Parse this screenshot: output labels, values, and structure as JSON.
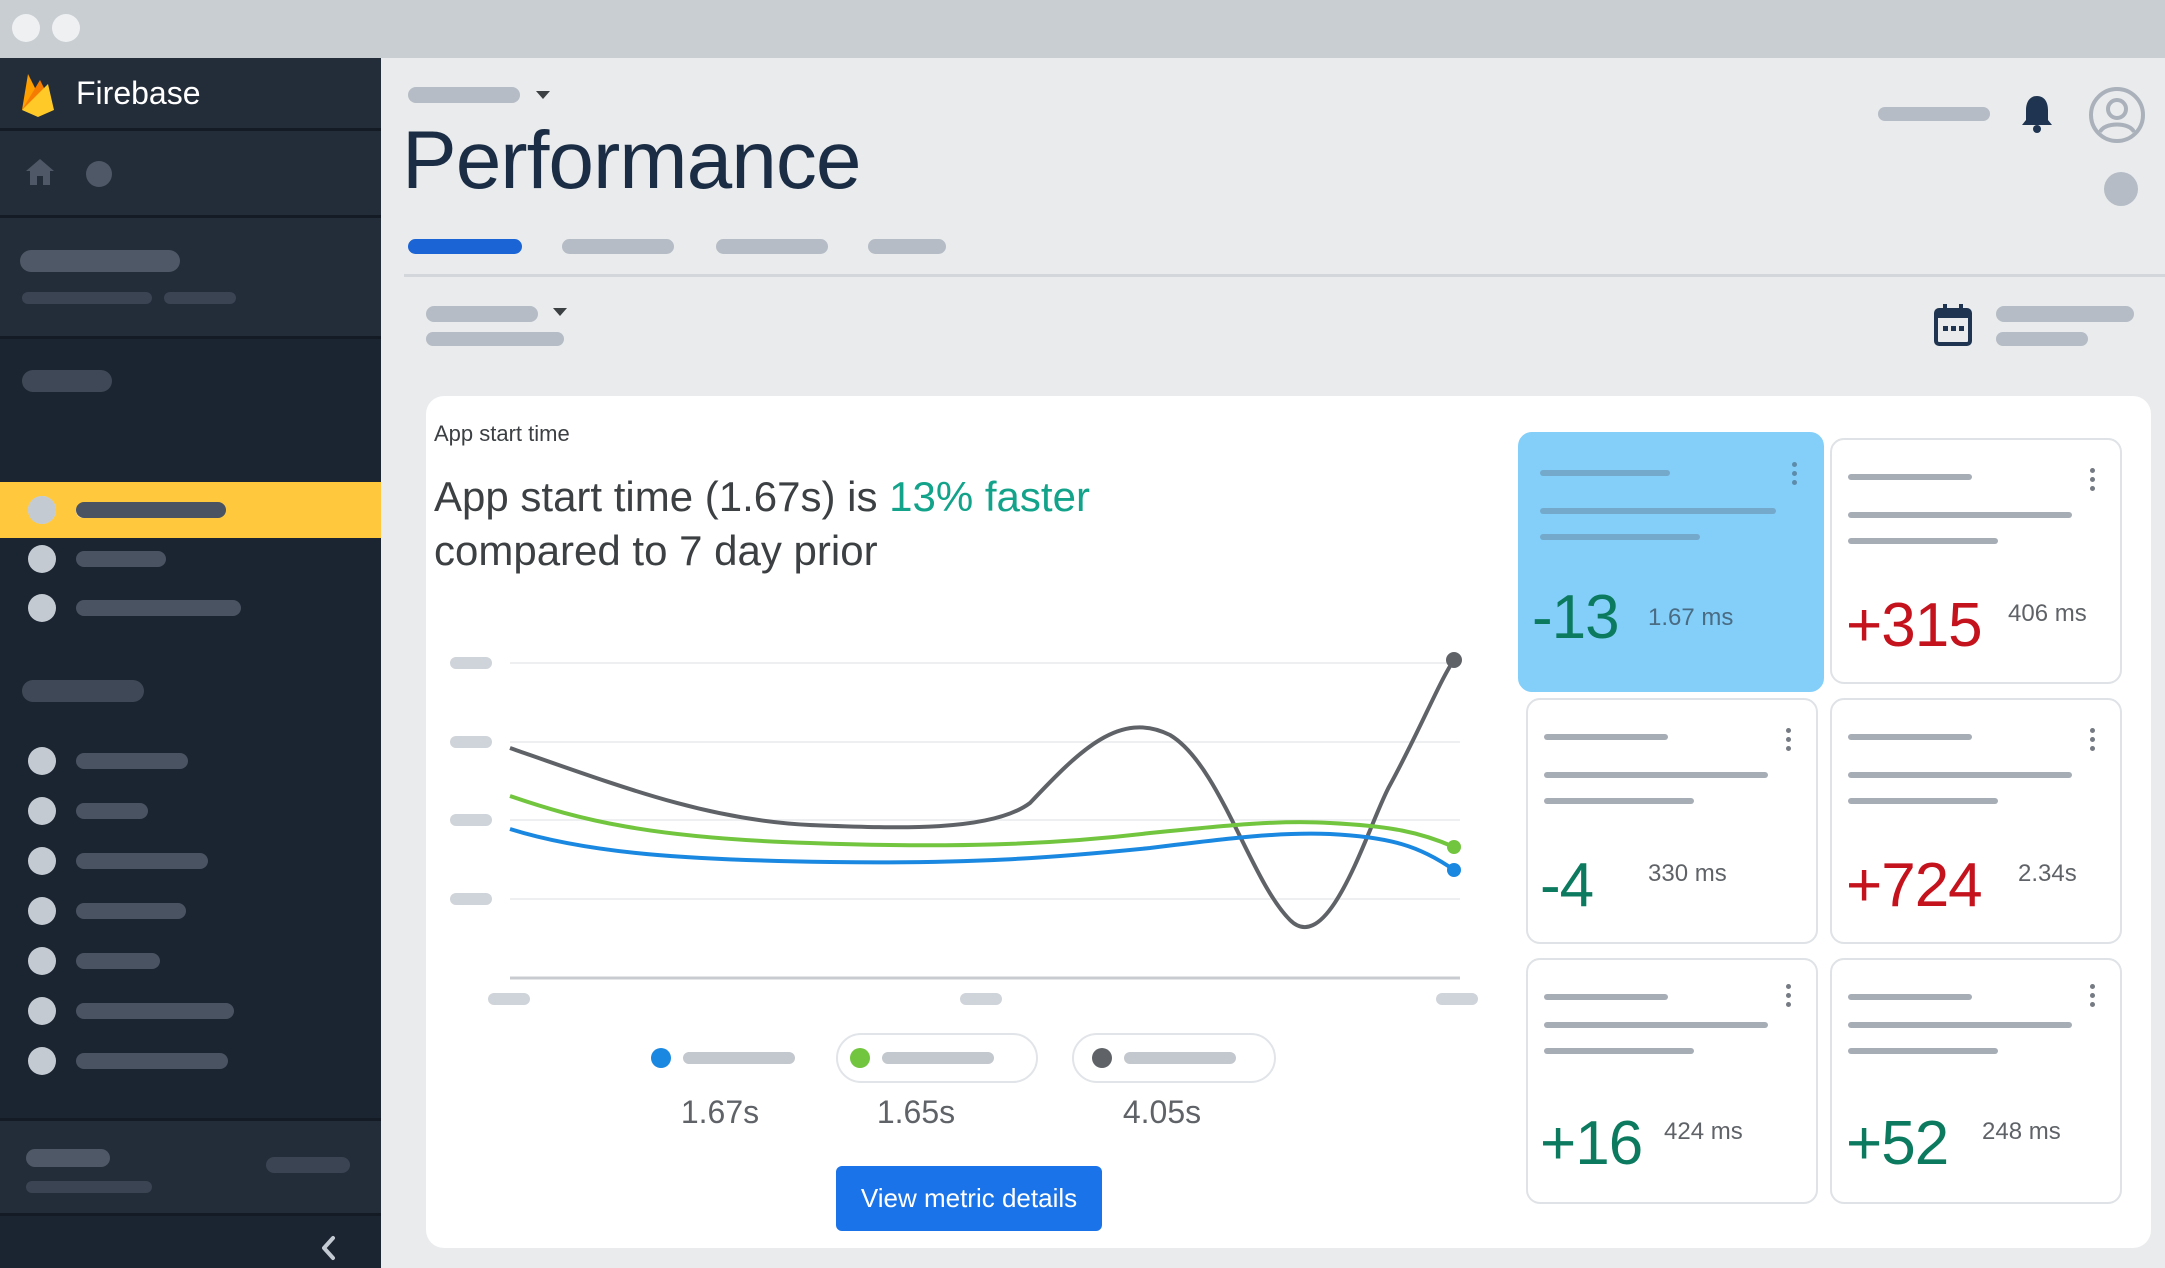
{
  "app": {
    "name": "Firebase"
  },
  "page": {
    "title": "Performance"
  },
  "card": {
    "label": "App start time",
    "headline_pre": "App start time (1.67s) is ",
    "headline_highlight": "13% faster",
    "headline_post": "compared to 7 day prior",
    "legend": [
      {
        "value": "1.67s",
        "color": "#1a88e0"
      },
      {
        "value": "1.65s",
        "color": "#72c53e"
      },
      {
        "value": "4.05s",
        "color": "#5f6368"
      }
    ],
    "button_label": "View metric details"
  },
  "metrics": [
    {
      "value": "-13",
      "ms": "1.67 ms",
      "trend": "good",
      "highlighted": true
    },
    {
      "value": "+315",
      "ms": "406 ms",
      "trend": "bad"
    },
    {
      "value": "-4",
      "ms": "330 ms",
      "trend": "good"
    },
    {
      "value": "+724",
      "ms": "2.34s",
      "trend": "bad"
    },
    {
      "value": "+16",
      "ms": "424 ms",
      "trend": "good"
    },
    {
      "value": "+52",
      "ms": "248 ms",
      "trend": "good"
    }
  ],
  "icons": [
    "firebase-flame-icon",
    "home-icon",
    "bell-icon",
    "account-icon",
    "calendar-icon",
    "chevron-left-icon",
    "dropdown-arrow-icon",
    "kebab-menu-icon"
  ],
  "colors": {
    "accent": "#1a73e8",
    "sidebar": "#1b2431",
    "active_nav": "#ffc83d",
    "positive": "#0b7a5f",
    "negative": "#c5131e",
    "highlight_card": "#83cffa"
  }
}
